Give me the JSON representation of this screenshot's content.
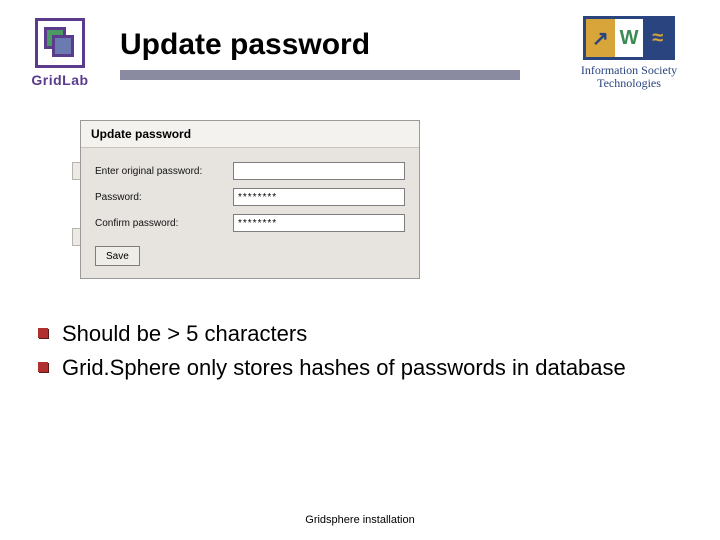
{
  "logos": {
    "gridlab_label": "GridLab",
    "ist_line1": "Information Society",
    "ist_line2": "Technologies",
    "ist_symbol1": "↗",
    "ist_symbol2": "W",
    "ist_symbol3": "≈"
  },
  "slide": {
    "title": "Update password",
    "footer": "Gridsphere installation"
  },
  "panel": {
    "title": "Update password",
    "fields": {
      "original": {
        "label": "Enter original password:",
        "value": ""
      },
      "password": {
        "label": "Password:",
        "value": "********"
      },
      "confirm": {
        "label": "Confirm password:",
        "value": "********"
      }
    },
    "save_label": "Save"
  },
  "bullets": {
    "b1": "Should be > 5 characters",
    "b2": "Grid.Sphere only stores hashes of passwords in database"
  }
}
